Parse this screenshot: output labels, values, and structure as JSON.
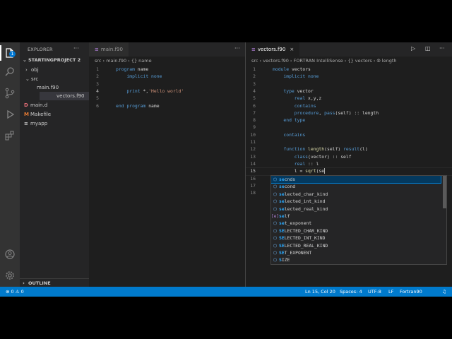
{
  "sidebar": {
    "title": "EXPLORER",
    "project": "STARTINGPROJECT 2",
    "items": [
      {
        "label": "obj",
        "type": "folder",
        "open": false
      },
      {
        "label": "src",
        "type": "folder",
        "open": true
      },
      {
        "label": "main.f90",
        "type": "file"
      },
      {
        "label": "vectors.f90",
        "type": "file",
        "selected": true
      },
      {
        "label": "main.d",
        "type": "file",
        "icon": "D",
        "color": "#e06c75"
      },
      {
        "label": "Makefile",
        "type": "file",
        "icon": "M",
        "color": "#e37933"
      },
      {
        "label": "myapp",
        "type": "file"
      }
    ],
    "outline": "OUTLINE"
  },
  "left_editor": {
    "tab": "main.f90",
    "breadcrumb": "src  ›  main.f90  ›  {} name",
    "lines": [
      {
        "n": "1",
        "text": "program name"
      },
      {
        "n": "2",
        "text": "    implicit none"
      },
      {
        "n": "3",
        "text": ""
      },
      {
        "n": "4",
        "text": "    print *,'Hello world'"
      },
      {
        "n": "5",
        "text": ""
      },
      {
        "n": "6",
        "text": "end program name"
      }
    ]
  },
  "right_editor": {
    "tab": "vectors.f90",
    "breadcrumb": "src  ›  vectors.f90  ›  FORTRAN IntelliSense  ›  {} vectors  ›  ⦾ length",
    "lines": [
      {
        "n": "1",
        "text": "module vectors"
      },
      {
        "n": "2",
        "text": "    implicit none"
      },
      {
        "n": "3",
        "text": ""
      },
      {
        "n": "4",
        "text": "    type vector"
      },
      {
        "n": "5",
        "text": "        real x,y,z"
      },
      {
        "n": "6",
        "text": "        contains"
      },
      {
        "n": "7",
        "text": "        procedure, pass(self) :: length"
      },
      {
        "n": "8",
        "text": "    end type"
      },
      {
        "n": "9",
        "text": ""
      },
      {
        "n": "10",
        "text": "    contains"
      },
      {
        "n": "11",
        "text": ""
      },
      {
        "n": "12",
        "text": "    function length(self) result(l)"
      },
      {
        "n": "13",
        "text": "        class(vector) :: self"
      },
      {
        "n": "14",
        "text": "        real :: l"
      },
      {
        "n": "15",
        "text": "        l = sqrt(se"
      },
      {
        "n": "16",
        "text": ""
      },
      {
        "n": "17",
        "text": ""
      },
      {
        "n": "18",
        "text": ""
      }
    ]
  },
  "suggestions": [
    {
      "label": "secnds",
      "kind": "fn"
    },
    {
      "label": "second",
      "kind": "fn"
    },
    {
      "label": "selected_char_kind",
      "kind": "fn"
    },
    {
      "label": "selected_int_kind",
      "kind": "fn"
    },
    {
      "label": "selected_real_kind",
      "kind": "fn"
    },
    {
      "label": "self",
      "kind": "var"
    },
    {
      "label": "set_exponent",
      "kind": "fn"
    },
    {
      "label": "SELECTED_CHAR_KIND",
      "kind": "fn"
    },
    {
      "label": "SELECTED_INT_KIND",
      "kind": "fn"
    },
    {
      "label": "SELECTED_REAL_KIND",
      "kind": "fn"
    },
    {
      "label": "SET_EXPONENT",
      "kind": "fn"
    },
    {
      "label": "SIZE",
      "kind": "fn"
    }
  ],
  "status": {
    "problems": "⊗ 0  ⚠ 0",
    "position": "Ln 15, Col 20",
    "spaces": "Spaces: 4",
    "encoding": "UTF-8",
    "eol": "LF",
    "language": "Fortran90",
    "bell": "♫"
  },
  "colors": {
    "accent": "#007acc",
    "badge": "1"
  }
}
